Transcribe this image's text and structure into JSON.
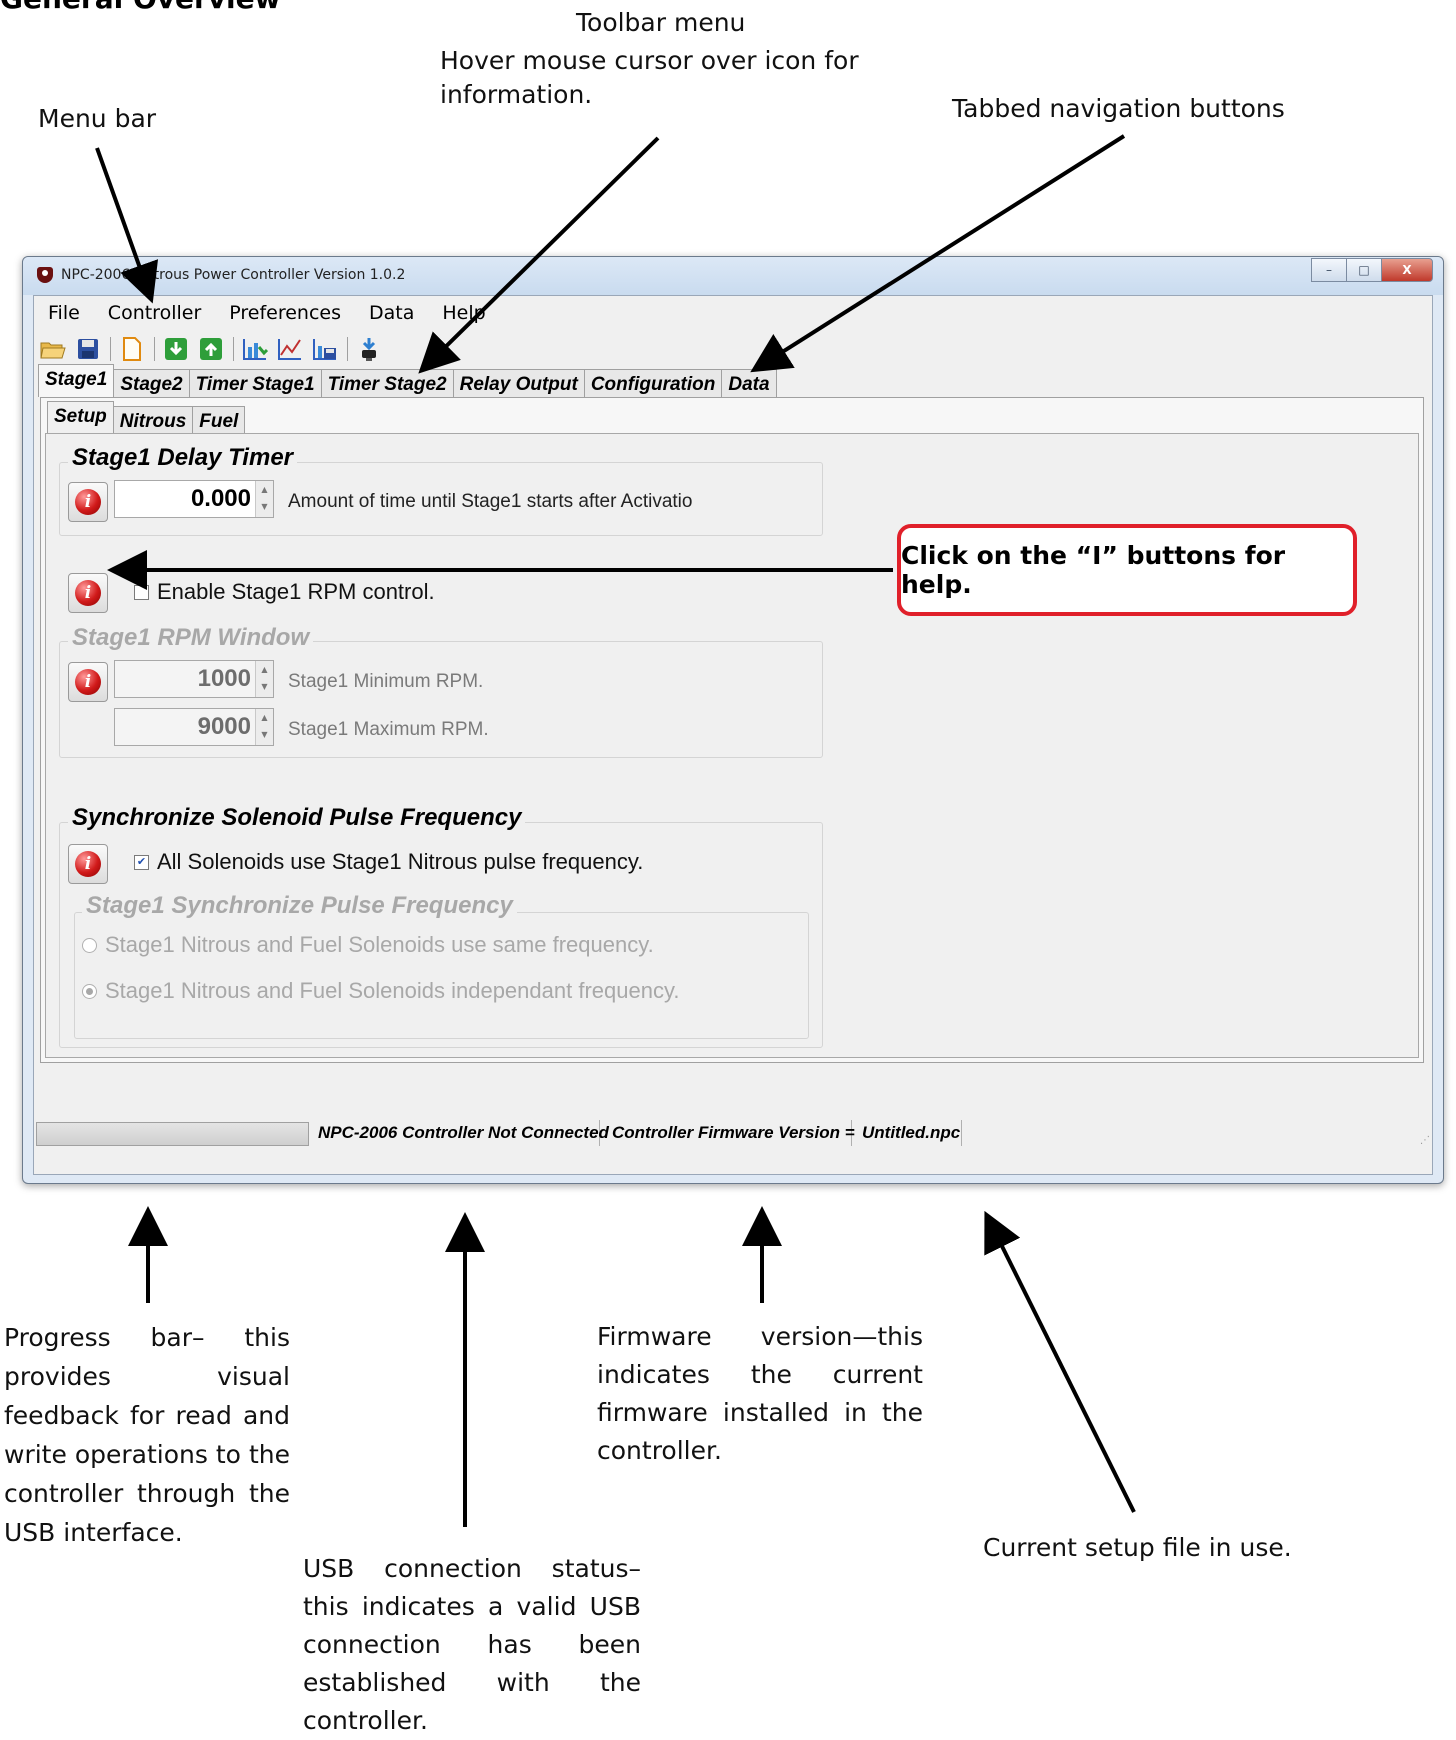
{
  "page_heading": "General Overview",
  "annotations": {
    "toolbar_menu": "Toolbar menu",
    "toolbar_hint": "Hover mouse cursor over icon for information.",
    "menu_bar": "Menu bar",
    "tabbed_nav": "Tabbed navigation buttons",
    "callout": "Click on the “I” buttons for help.",
    "progress_bar": "Progress bar– this provides visual feedback for read and write operations to the controller through the USB interface.",
    "firmware": "Firmware version—this indicates the current firmware installed in the controller.",
    "usb_status": "USB connection status– this indicates a valid USB connection has been established with the controller.",
    "setup_file": "Current setup file in use."
  },
  "window": {
    "title": "NPC-2006, Nitrous Power Controller Version 1.0.2",
    "controls": {
      "minimize": "–",
      "maximize": "□",
      "close": "X"
    }
  },
  "menubar": [
    "File",
    "Controller",
    "Preferences",
    "Data",
    "Help"
  ],
  "toolbar": {
    "icons": [
      "open-folder-icon",
      "save-disk-icon",
      "new-file-icon",
      "download-green-icon",
      "upload-green-icon",
      "read-chart-icon",
      "line-chart-icon",
      "save-chart-icon",
      "usb-plug-icon"
    ]
  },
  "tabs": [
    "Stage1",
    "Stage2",
    "Timer Stage1",
    "Timer Stage2",
    "Relay Output",
    "Configuration",
    "Data"
  ],
  "active_tab": "Stage1",
  "subtabs": [
    "Setup",
    "Nitrous",
    "Fuel"
  ],
  "active_subtab": "Setup",
  "delay_timer": {
    "title": "Stage1 Delay Timer",
    "value": "0.000",
    "description": "Amount of time until Stage1 starts after Activatio"
  },
  "rpm_control": {
    "label": "Enable Stage1 RPM control.",
    "checked": false
  },
  "rpm_window": {
    "title": "Stage1 RPM Window",
    "min_value": "1000",
    "min_label": "Stage1 Minimum RPM.",
    "max_value": "9000",
    "max_label": "Stage1 Maximum RPM."
  },
  "sync": {
    "title": "Synchronize Solenoid Pulse Frequency",
    "checkbox_label": "All Solenoids use Stage1 Nitrous pulse frequency.",
    "checked": true,
    "sub_title": "Stage1 Synchronize Pulse Frequency",
    "radio_same": "Stage1 Nitrous and Fuel Solenoids use same frequency.",
    "radio_independent": "Stage1 Nitrous and Fuel Solenoids independant frequency.",
    "selected": "independent"
  },
  "statusbar": {
    "progress": 0,
    "connection": "NPC-2006 Controller Not Connected",
    "firmware": "Controller Firmware Version =",
    "file": "Untitled.npc"
  },
  "colors": {
    "callout_border": "#e0202a",
    "info_button": "#d11a1a",
    "window_frame": "#dfe9f5"
  }
}
